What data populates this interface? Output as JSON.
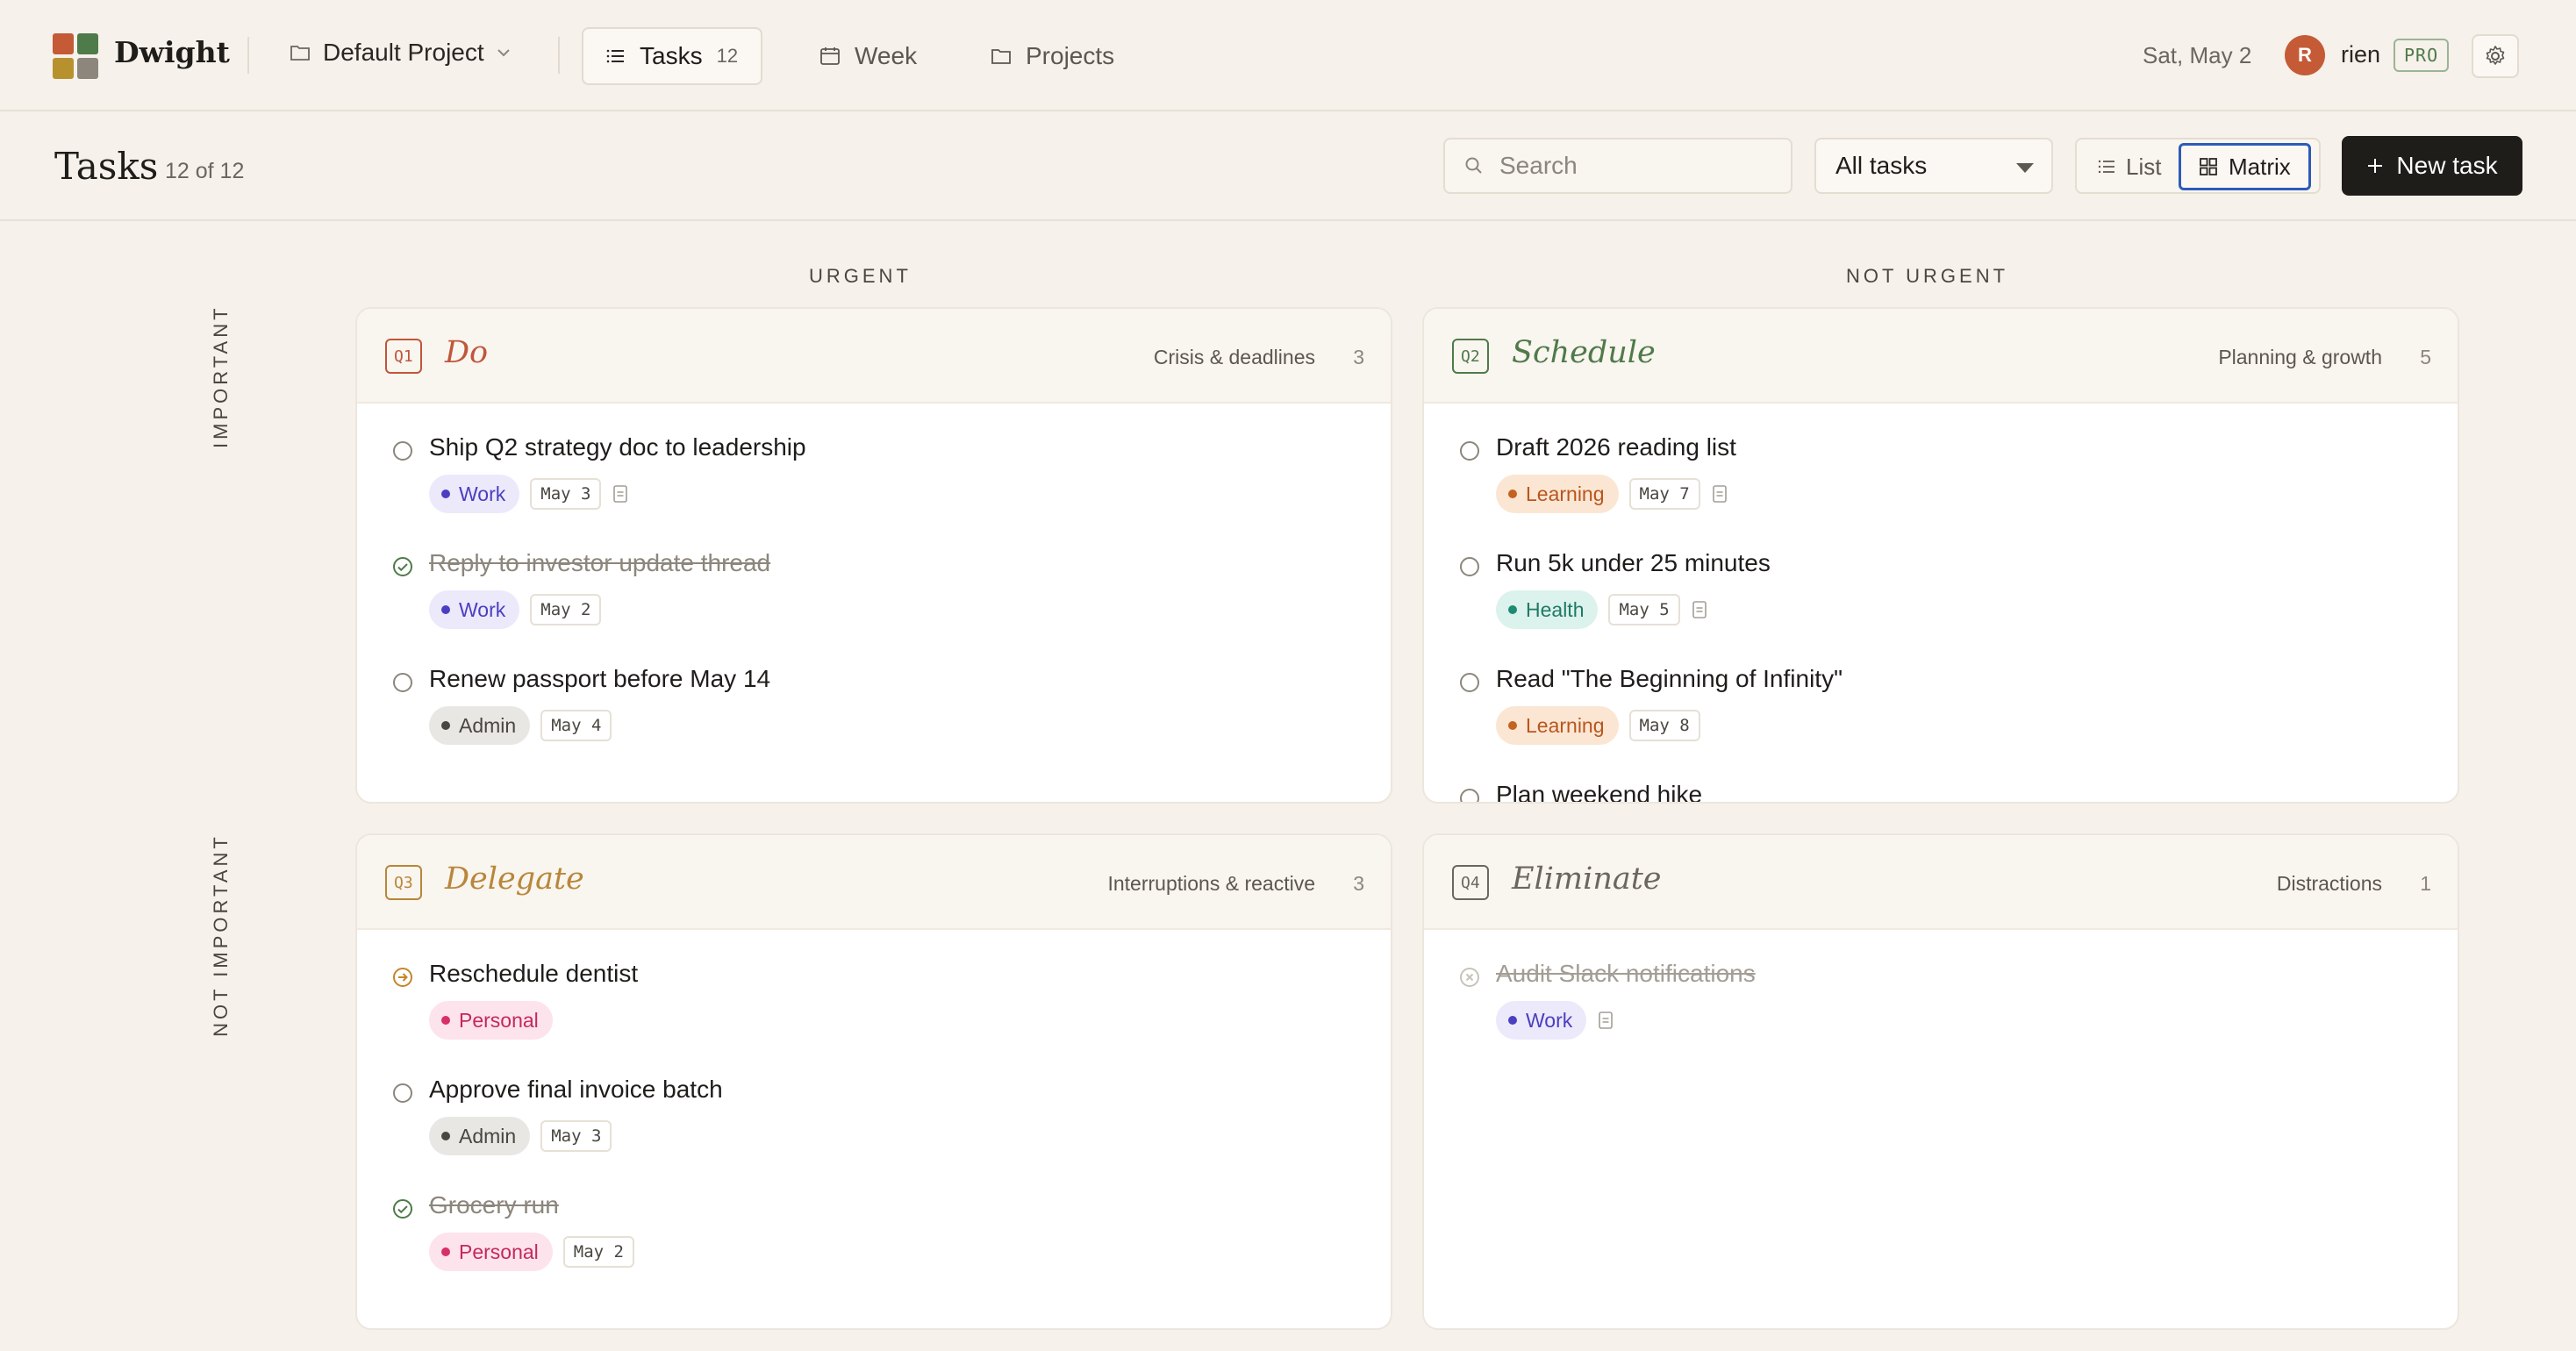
{
  "app": {
    "brand": "Dwight",
    "logo_colors": [
      "#c45b36",
      "#4f7a4a",
      "#b8912f",
      "#8c867c"
    ]
  },
  "nav": {
    "project": "Default Project",
    "tasks_label": "Tasks",
    "tasks_count": "12",
    "week_label": "Week",
    "projects_label": "Projects"
  },
  "user": {
    "date": "Sat, May 2",
    "initial": "R",
    "name": "rien",
    "plan": "PRO"
  },
  "header": {
    "title": "Tasks",
    "count": "12 of 12",
    "search_placeholder": "Search",
    "filter_value": "All tasks",
    "view_list": "List",
    "view_matrix": "Matrix",
    "active_view": "Matrix",
    "new_task": "New task"
  },
  "matrix": {
    "col_urgent": "URGENT",
    "col_not_urgent": "NOT URGENT",
    "row_important": "IMPORTANT",
    "row_not_important": "NOT IMPORTANT",
    "quadrants": [
      {
        "badge": "Q1",
        "title": "Do",
        "subtitle": "Crisis & deadlines",
        "count": "3",
        "color": "#c0563a",
        "tasks": [
          {
            "title": "Ship Q2 strategy doc to leadership",
            "status": "open",
            "tag": "Work",
            "due": "May 3",
            "note": true
          },
          {
            "title": "Reply to investor update thread",
            "status": "done",
            "tag": "Work",
            "due": "May 2",
            "note": false
          },
          {
            "title": "Renew passport before May 14",
            "status": "open",
            "tag": "Admin",
            "due": "May 4",
            "note": false
          }
        ]
      },
      {
        "badge": "Q2",
        "title": "Schedule",
        "subtitle": "Planning & growth",
        "count": "5",
        "color": "#4f7a4a",
        "tasks": [
          {
            "title": "Draft 2026 reading list",
            "status": "open",
            "tag": "Learning",
            "due": "May 7",
            "note": true
          },
          {
            "title": "Run 5k under 25 minutes",
            "status": "open",
            "tag": "Health",
            "due": "May 5",
            "note": true
          },
          {
            "title": "Read \"The Beginning of Infinity\"",
            "status": "open",
            "tag": "Learning",
            "due": "May 8",
            "note": false
          },
          {
            "title": "Plan weekend hike",
            "status": "open",
            "tag": "",
            "due": "",
            "note": false
          }
        ]
      },
      {
        "badge": "Q3",
        "title": "Delegate",
        "subtitle": "Interruptions & reactive",
        "count": "3",
        "color": "#b8873a",
        "tasks": [
          {
            "title": "Reschedule dentist",
            "status": "delegated",
            "tag": "Personal",
            "due": "",
            "note": false
          },
          {
            "title": "Approve final invoice batch",
            "status": "open",
            "tag": "Admin",
            "due": "May 3",
            "note": false
          },
          {
            "title": "Grocery run",
            "status": "done",
            "tag": "Personal",
            "due": "May 2",
            "note": false
          }
        ]
      },
      {
        "badge": "Q4",
        "title": "Eliminate",
        "subtitle": "Distractions",
        "count": "1",
        "color": "#6b665e",
        "tasks": [
          {
            "title": "Audit Slack notifications",
            "status": "cancelled",
            "tag": "Work",
            "due": "",
            "note": true
          }
        ]
      }
    ]
  },
  "tag_styles": {
    "Work": {
      "bg": "#ece9fb",
      "fg": "#4a3fc0",
      "dot": "#4a3fc0"
    },
    "Admin": {
      "bg": "#e9e7e3",
      "fg": "#4a4640",
      "dot": "#4a4640"
    },
    "Learning": {
      "bg": "#fbe6d3",
      "fg": "#b8561e",
      "dot": "#c4631f"
    },
    "Health": {
      "bg": "#dcf2ec",
      "fg": "#1f7a66",
      "dot": "#1f8a72"
    },
    "Personal": {
      "bg": "#fde3ec",
      "fg": "#c4285e",
      "dot": "#d62f6a"
    }
  }
}
